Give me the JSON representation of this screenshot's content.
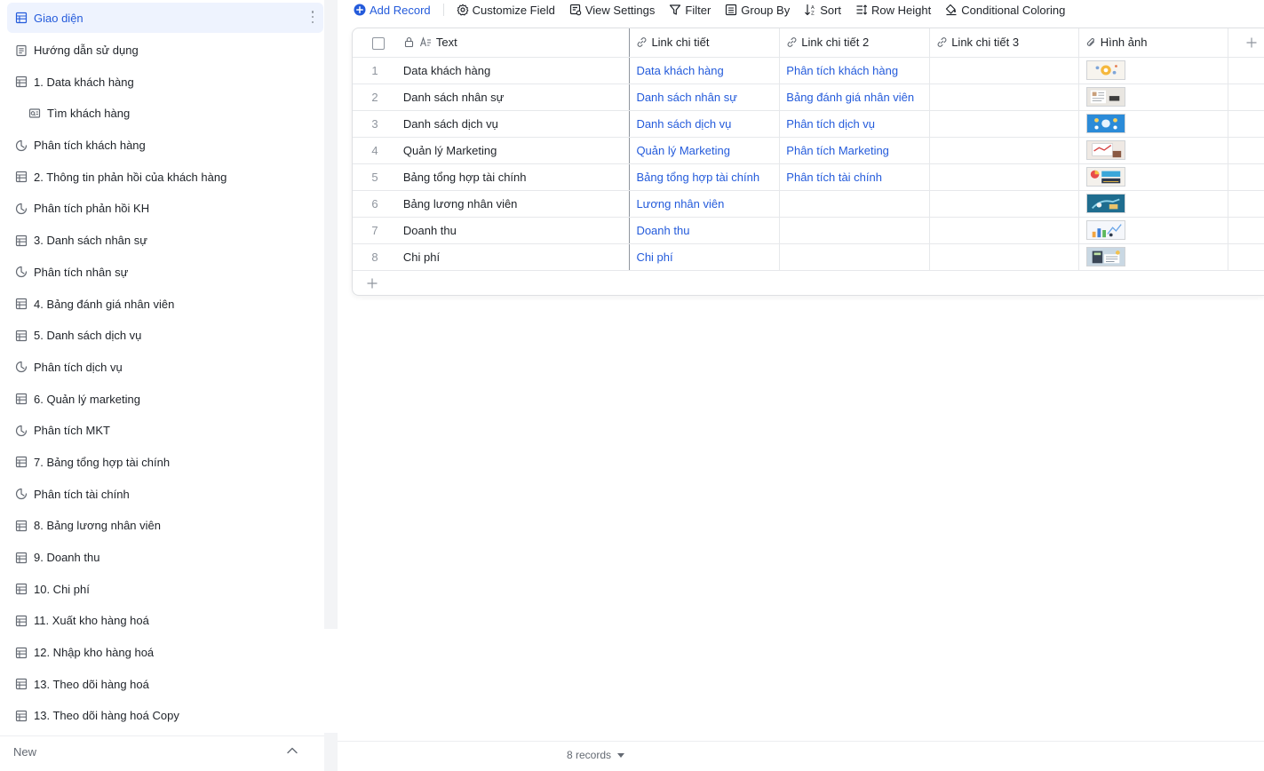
{
  "sidebar": {
    "items": [
      {
        "label": "Giao diện",
        "icon": "grid-table-icon"
      },
      {
        "label": "Hướng dẫn sử dụng",
        "icon": "document-icon"
      },
      {
        "label": "1. Data khách hàng",
        "icon": "grid-table-icon"
      },
      {
        "label": "Tìm khách hàng",
        "icon": "form-search-icon"
      },
      {
        "label": "Phân tích khách hàng",
        "icon": "dashboard-gauge-icon"
      },
      {
        "label": "2. Thông tin phản hồi của khách hàng",
        "icon": "grid-table-icon"
      },
      {
        "label": "Phân tích phản hồi KH",
        "icon": "dashboard-gauge-icon"
      },
      {
        "label": "3. Danh sách nhân sự",
        "icon": "grid-table-icon"
      },
      {
        "label": "Phân tích nhân sự",
        "icon": "dashboard-gauge-icon"
      },
      {
        "label": "4. Bảng đánh giá nhân viên",
        "icon": "grid-table-icon"
      },
      {
        "label": "5. Danh sách dịch vụ",
        "icon": "grid-table-icon"
      },
      {
        "label": "Phân tích dịch vụ",
        "icon": "dashboard-gauge-icon"
      },
      {
        "label": "6. Quản lý marketing",
        "icon": "grid-table-icon"
      },
      {
        "label": "Phân tích MKT",
        "icon": "dashboard-gauge-icon"
      },
      {
        "label": "7. Bảng tổng hợp tài chính",
        "icon": "grid-table-icon"
      },
      {
        "label": "Phân tích tài chính",
        "icon": "dashboard-gauge-icon"
      },
      {
        "label": "8. Bảng lương nhân viên",
        "icon": "grid-table-icon"
      },
      {
        "label": "9. Doanh thu",
        "icon": "grid-table-icon"
      },
      {
        "label": "10. Chi phí",
        "icon": "grid-table-icon"
      },
      {
        "label": "11. Xuất kho hàng hoá",
        "icon": "grid-table-icon"
      },
      {
        "label": "12. Nhập kho hàng hoá",
        "icon": "grid-table-icon"
      },
      {
        "label": "13. Theo dõi hàng hoá",
        "icon": "grid-table-icon"
      },
      {
        "label": "13. Theo dõi hàng hoá Copy",
        "icon": "grid-table-icon"
      }
    ],
    "new_label": "New"
  },
  "toolbar": {
    "add_record": "Add Record",
    "customize_field": "Customize Field",
    "view_settings": "View Settings",
    "filter": "Filter",
    "group_by": "Group By",
    "sort": "Sort",
    "row_height": "Row Height",
    "conditional_coloring": "Conditional Coloring"
  },
  "table": {
    "columns": [
      "Text",
      "Link chi tiết",
      "Link chi tiết 2",
      "Link chi tiết 3",
      "Hình ảnh"
    ],
    "rows": [
      {
        "n": "1",
        "text": "Data khách hàng",
        "link1": "Data khách hàng",
        "link2": "Phân tích khách hàng",
        "link3": "",
        "image": "gear-people-thumbnail"
      },
      {
        "n": "2",
        "text": "Danh sách nhân sự",
        "link1": "Danh sách nhân sự",
        "link2": "Bảng đánh giá nhân viên",
        "link3": "",
        "image": "resume-thumbnail"
      },
      {
        "n": "3",
        "text": "Danh sách dịch vụ",
        "link1": "Danh sách dịch vụ",
        "link2": "Phân tích dịch vụ",
        "link3": "",
        "image": "service-icons-thumbnail"
      },
      {
        "n": "4",
        "text": "Quản lý Marketing",
        "link1": "Quản lý Marketing",
        "link2": "Phân tích Marketing",
        "link3": "",
        "image": "marketing-thumbnail"
      },
      {
        "n": "5",
        "text": "Bảng tổng hợp tài chính",
        "link1": "Bảng tổng hợp tài chính",
        "link2": "Phân tích tài chính",
        "link3": "",
        "image": "finance-charts-thumbnail"
      },
      {
        "n": "6",
        "text": "Bảng lương nhân viên",
        "link1": "Lương nhân viên",
        "link2": "",
        "link3": "",
        "image": "salary-thumbnail"
      },
      {
        "n": "7",
        "text": "Doanh thu",
        "link1": "Doanh thu",
        "link2": "",
        "link3": "",
        "image": "revenue-thumbnail"
      },
      {
        "n": "8",
        "text": "Chi phí",
        "link1": "Chi phí",
        "link2": "",
        "link3": "",
        "image": "costs-calculator-thumbnail"
      }
    ]
  },
  "footer": {
    "records": "8 records"
  },
  "colors": {
    "accent": "#245bdb",
    "active_bg": "#eef3fe",
    "text": "#1f2329",
    "muted": "#8f959e"
  }
}
